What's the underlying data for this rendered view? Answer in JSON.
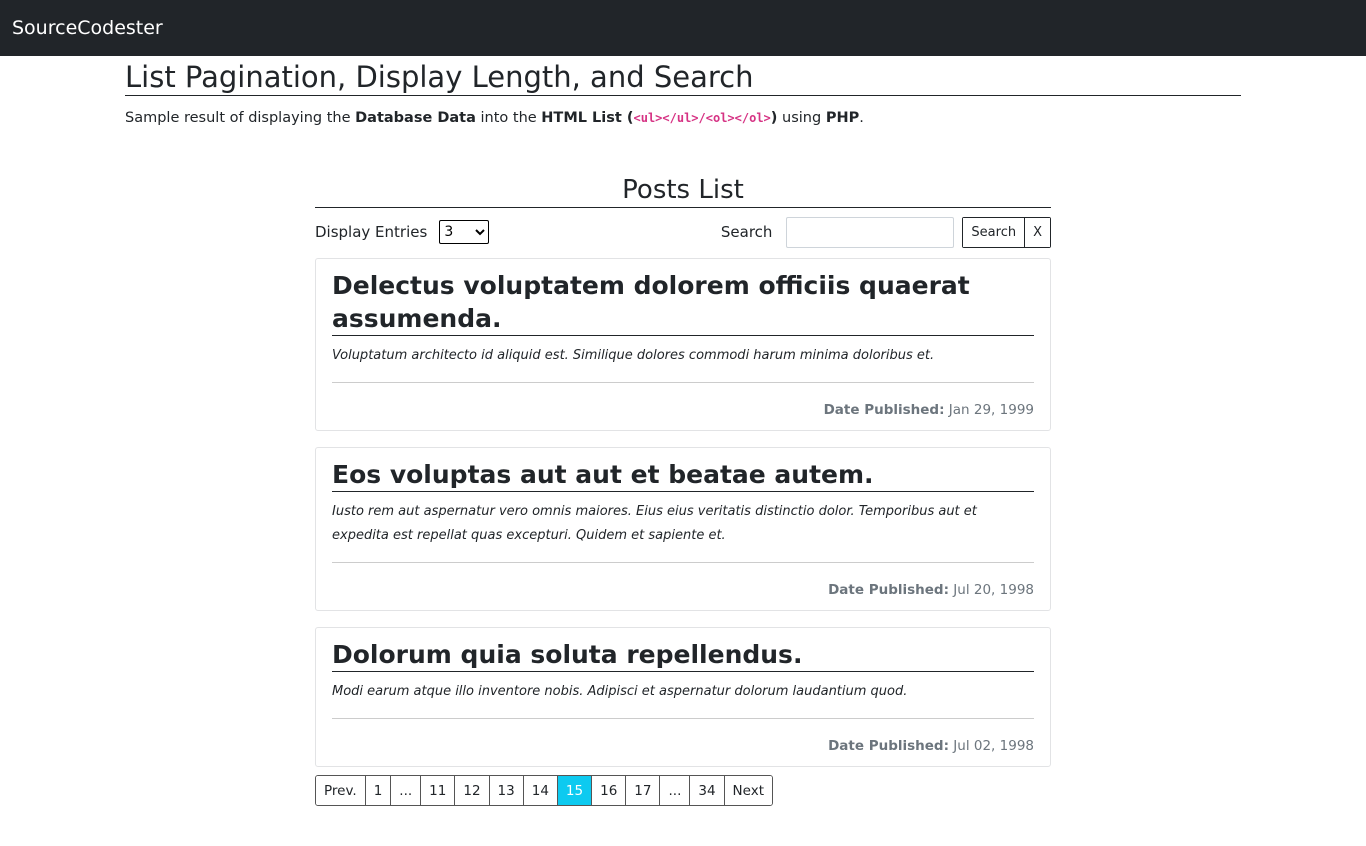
{
  "navbar": {
    "brand": "SourceCodester"
  },
  "header": {
    "title": "List Pagination, Display Length, and Search",
    "subtitle": {
      "t1": "Sample result of displaying the ",
      "b1": "Database Data",
      "t2": " into the ",
      "b2": "HTML List",
      "t3": " (",
      "code": "<ul></ul>/<ol></ol>",
      "t4": ")",
      "t5": " using ",
      "b3": "PHP",
      "t6": "."
    }
  },
  "list": {
    "title": "Posts List",
    "entries_label": "Display Entries",
    "entries_value": "3",
    "search_label": "Search",
    "search_value": "",
    "search_button": "Search",
    "clear_button": "X",
    "date_label": "Date Published:",
    "posts": [
      {
        "title": "Delectus voluptatem dolorem officiis quaerat assumenda.",
        "body": "Voluptatum architecto id aliquid est. Similique dolores commodi harum minima doloribus et.",
        "date": "Jan 29, 1999"
      },
      {
        "title": "Eos voluptas aut aut et beatae autem.",
        "body": "Iusto rem aut aspernatur vero omnis maiores. Eius eius veritatis distinctio dolor. Temporibus aut et expedita est repellat quas excepturi. Quidem et sapiente et.",
        "date": "Jul 20, 1998"
      },
      {
        "title": "Dolorum quia soluta repellendus.",
        "body": "Modi earum atque illo inventore nobis. Adipisci et aspernatur dolorum laudantium quod.",
        "date": "Jul 02, 1998"
      }
    ]
  },
  "pagination": {
    "pages": [
      "Prev.",
      "1",
      "...",
      "11",
      "12",
      "13",
      "14",
      "15",
      "16",
      "17",
      "...",
      "34",
      "Next"
    ],
    "active": "15"
  },
  "colors": {
    "navbar": "#212529",
    "active_page": "#0dcaf0",
    "code": "#d63384"
  }
}
